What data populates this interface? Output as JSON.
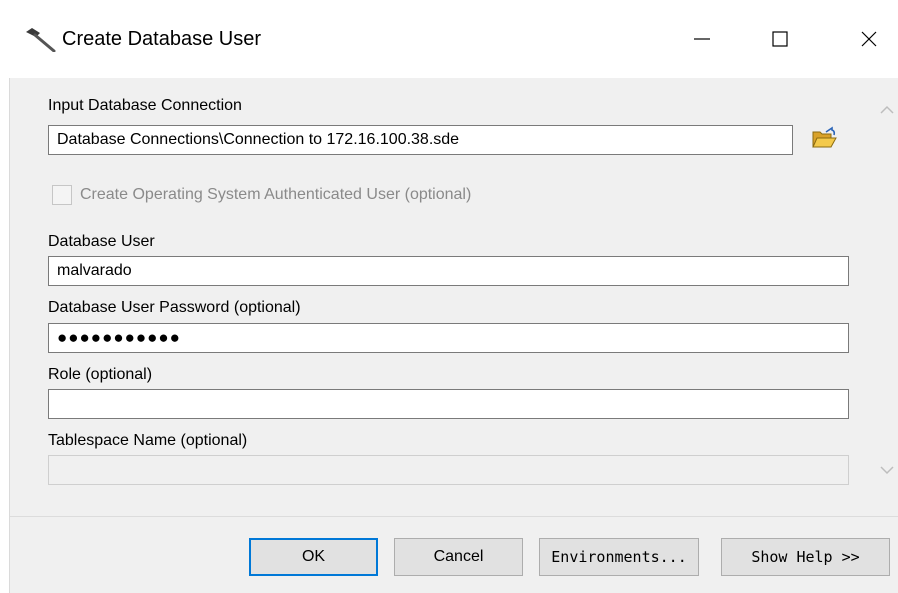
{
  "window": {
    "title": "Create Database User",
    "icon": "hammer-icon",
    "controls": [
      "minimize-icon",
      "maximize-icon",
      "close-icon"
    ]
  },
  "form": {
    "input_connection": {
      "label": "Input Database Connection",
      "value": "Database Connections\\Connection to 172.16.100.38.sde",
      "browse_icon": "open-folder-icon"
    },
    "os_auth": {
      "label": "Create Operating System Authenticated User (optional)",
      "checked": false,
      "enabled": false
    },
    "database_user": {
      "label": "Database User",
      "value": "malvarado"
    },
    "password": {
      "label": "Database User Password (optional)",
      "value": "●●●●●●●●●●●"
    },
    "role": {
      "label": "Role (optional)",
      "value": ""
    },
    "tablespace": {
      "label": "Tablespace Name (optional)",
      "value": "",
      "enabled": false
    }
  },
  "buttons": {
    "ok": "OK",
    "cancel": "Cancel",
    "environments": "Environments...",
    "show_help": "Show Help >>"
  },
  "colors": {
    "dialog_bg": "#f0f0f0",
    "default_button_border": "#0078d7",
    "folder_yellow": "#e8b230"
  }
}
